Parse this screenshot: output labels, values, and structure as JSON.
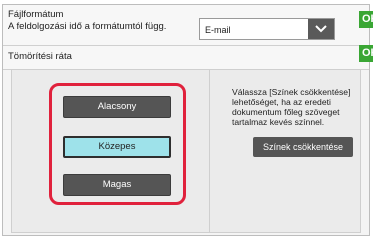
{
  "format": {
    "title": "Fájlformátum",
    "note": "A feldolgozási idő a formátumtól függ.",
    "selected_value": "E-mail",
    "ok_label": "OK"
  },
  "compression": {
    "title": "Tömörítési ráta",
    "ok_label": "OK",
    "options": [
      {
        "label": "Alacsony",
        "selected": false
      },
      {
        "label": "Közepes",
        "selected": true
      },
      {
        "label": "Magas",
        "selected": false
      }
    ]
  },
  "reduce_colors": {
    "info_line1": "Válassza [Színek csökkentése]",
    "info_line2": "lehetőséget,  ha az eredeti",
    "info_line3": "dokumentum főleg szöveget",
    "info_line4": "tartalmaz kevés színnel.",
    "button_label": "Színek csökkentése"
  },
  "colors": {
    "highlight": "#e0213c",
    "selected_button": "#9ee2ea",
    "ok_green": "#3aa634",
    "dark_button": "#555555"
  },
  "icons": {
    "dropdown": "chevron-down-icon"
  }
}
